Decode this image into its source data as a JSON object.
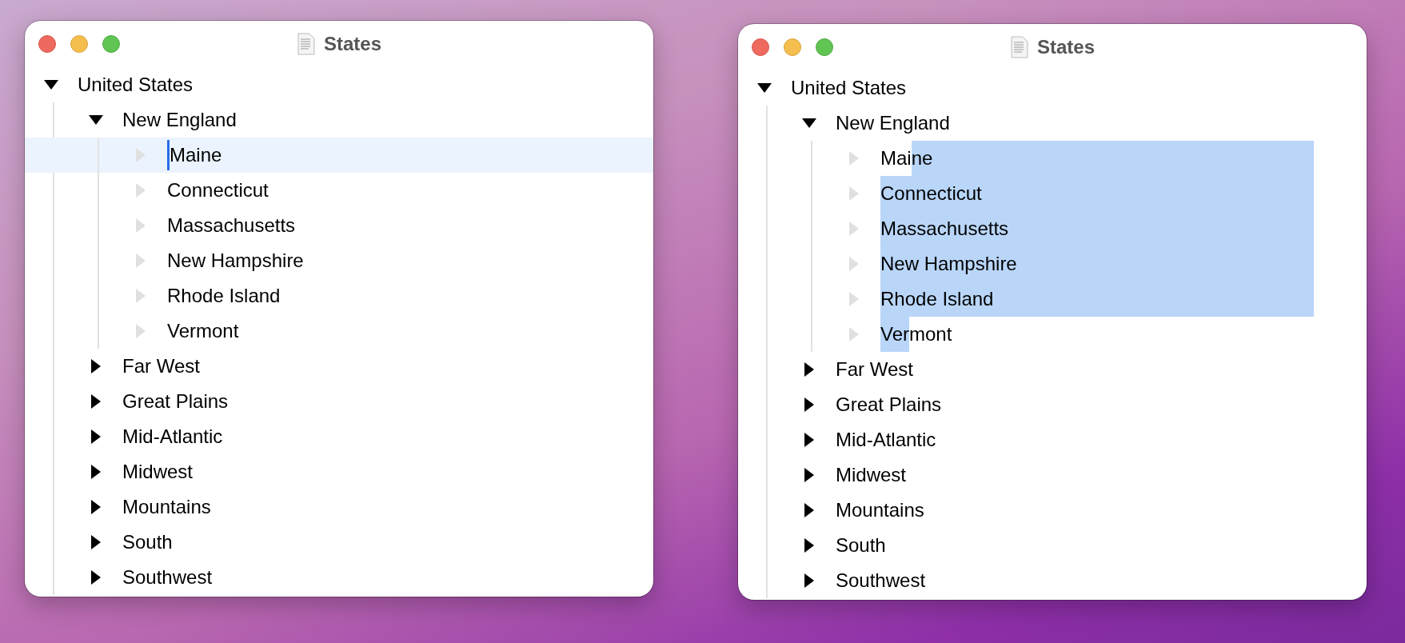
{
  "windows": [
    {
      "title": "States",
      "tree": [
        {
          "label": "United States",
          "expanded": true,
          "disabled": false,
          "selected": false,
          "caret": false,
          "children": [
            {
              "label": "New England",
              "expanded": true,
              "disabled": false,
              "selected": false,
              "caret": false,
              "children": [
                {
                  "label": "Maine",
                  "expanded": false,
                  "disabled": true,
                  "selected": true,
                  "caret": true
                },
                {
                  "label": "Connecticut",
                  "expanded": false,
                  "disabled": true,
                  "selected": false,
                  "caret": false
                },
                {
                  "label": "Massachusetts",
                  "expanded": false,
                  "disabled": true,
                  "selected": false,
                  "caret": false
                },
                {
                  "label": "New Hampshire",
                  "expanded": false,
                  "disabled": true,
                  "selected": false,
                  "caret": false
                },
                {
                  "label": "Rhode Island",
                  "expanded": false,
                  "disabled": true,
                  "selected": false,
                  "caret": false
                },
                {
                  "label": "Vermont",
                  "expanded": false,
                  "disabled": true,
                  "selected": false,
                  "caret": false
                }
              ]
            },
            {
              "label": "Far West",
              "expanded": false,
              "disabled": false,
              "selected": false,
              "caret": false
            },
            {
              "label": "Great Plains",
              "expanded": false,
              "disabled": false,
              "selected": false,
              "caret": false
            },
            {
              "label": "Mid-Atlantic",
              "expanded": false,
              "disabled": false,
              "selected": false,
              "caret": false
            },
            {
              "label": "Midwest",
              "expanded": false,
              "disabled": false,
              "selected": false,
              "caret": false
            },
            {
              "label": "Mountains",
              "expanded": false,
              "disabled": false,
              "selected": false,
              "caret": false
            },
            {
              "label": "South",
              "expanded": false,
              "disabled": false,
              "selected": false,
              "caret": false
            },
            {
              "label": "Southwest",
              "expanded": false,
              "disabled": false,
              "selected": false,
              "caret": false
            }
          ]
        }
      ]
    },
    {
      "title": "States",
      "tree": [
        {
          "label": "United States",
          "expanded": true,
          "disabled": false,
          "children": [
            {
              "label": "New England",
              "expanded": true,
              "disabled": false,
              "children": [
                {
                  "label_parts": [
                    {
                      "text": "Mai",
                      "highlighted": false
                    },
                    {
                      "text": "ne",
                      "highlighted": true
                    }
                  ],
                  "highlight_to_end": true,
                  "expanded": false,
                  "disabled": true
                },
                {
                  "label_parts": [
                    {
                      "text": "Connecticut",
                      "highlighted": true
                    }
                  ],
                  "highlight_to_end": true,
                  "expanded": false,
                  "disabled": true
                },
                {
                  "label_parts": [
                    {
                      "text": "Massachusetts",
                      "highlighted": true
                    }
                  ],
                  "highlight_to_end": true,
                  "expanded": false,
                  "disabled": true
                },
                {
                  "label_parts": [
                    {
                      "text": "New Hampshire",
                      "highlighted": true
                    }
                  ],
                  "highlight_to_end": true,
                  "expanded": false,
                  "disabled": true
                },
                {
                  "label_parts": [
                    {
                      "text": "Rhode Island",
                      "highlighted": true
                    }
                  ],
                  "highlight_to_end": true,
                  "expanded": false,
                  "disabled": true
                },
                {
                  "label_parts": [
                    {
                      "text": "Ver",
                      "highlighted": true
                    },
                    {
                      "text": "mont",
                      "highlighted": false
                    }
                  ],
                  "highlight_to_end": false,
                  "expanded": false,
                  "disabled": true
                }
              ]
            },
            {
              "label": "Far West",
              "expanded": false,
              "disabled": false
            },
            {
              "label": "Great Plains",
              "expanded": false,
              "disabled": false
            },
            {
              "label": "Mid-Atlantic",
              "expanded": false,
              "disabled": false
            },
            {
              "label": "Midwest",
              "expanded": false,
              "disabled": false
            },
            {
              "label": "Mountains",
              "expanded": false,
              "disabled": false
            },
            {
              "label": "South",
              "expanded": false,
              "disabled": false
            },
            {
              "label": "Southwest",
              "expanded": false,
              "disabled": false
            }
          ]
        }
      ]
    }
  ]
}
